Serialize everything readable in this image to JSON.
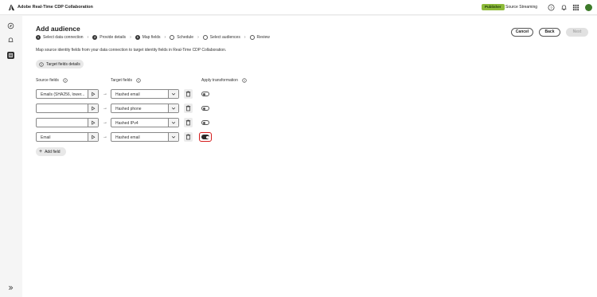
{
  "app": {
    "title": "Adobe Real-Time CDP Collaboration",
    "logo_icon": "adobe-logo-icon"
  },
  "header": {
    "badge": "Publisher",
    "source": "Source Streaming",
    "icons": [
      "help-icon",
      "bell-icon",
      "apps-grid-icon",
      "avatar"
    ]
  },
  "rail": {
    "icons": [
      "compass-icon",
      "bell-outline-icon",
      "audience-icon",
      "expand-icon"
    ]
  },
  "page": {
    "title": "Add audience",
    "steps": [
      {
        "num": "1",
        "label": "Select data connection"
      },
      {
        "num": "2",
        "label": "Provide details"
      },
      {
        "num": "3",
        "label": "Map fields"
      },
      {
        "num": "",
        "label": "Schedule"
      },
      {
        "num": "",
        "label": "Select audiences"
      },
      {
        "num": "",
        "label": "Review"
      }
    ],
    "actions": {
      "cancel": "Cancel",
      "back": "Back",
      "next": "Next"
    },
    "description": "Map source identity fields from your data connection to target identity fields in Real-Time CDP Collaboration.",
    "target_details_button": "Target fields details",
    "columns": {
      "source": "Source fields",
      "target": "Target fields",
      "transform": "Apply transformation"
    },
    "rows": [
      {
        "source": "Emails (SHA256, lower...",
        "target": "Hashed email",
        "transform": false
      },
      {
        "source": "",
        "target": "Hashed phone",
        "transform": false
      },
      {
        "source": "",
        "target": "Hashed IPv4",
        "transform": false
      },
      {
        "source": "Email",
        "target": "Hashed email",
        "transform": true
      }
    ],
    "add_field": "Add field"
  },
  "colors": {
    "accent": "#8dba3a",
    "focus": "#d41a1a",
    "dark": "#2b2b2b"
  }
}
